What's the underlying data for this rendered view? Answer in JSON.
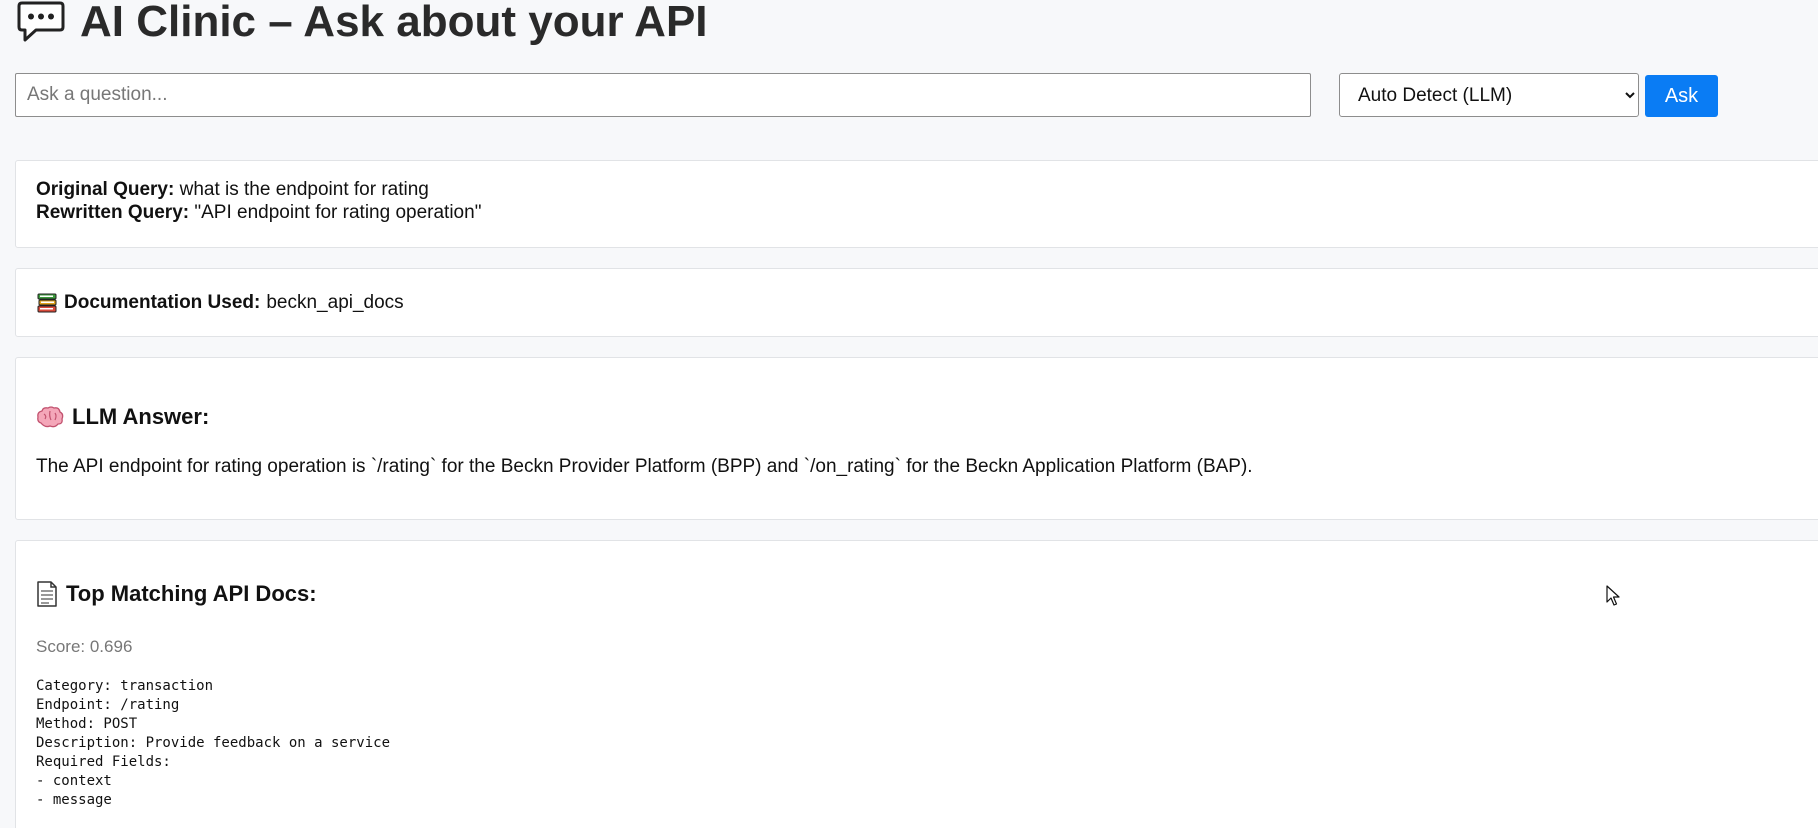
{
  "header": {
    "title": "AI Clinic – Ask about your API",
    "icon": "speech-bubble-icon"
  },
  "search": {
    "placeholder": "Ask a question...",
    "value": ""
  },
  "mode": {
    "selected": "Auto Detect (LLM)",
    "options": [
      "Auto Detect (LLM)"
    ]
  },
  "ask_button": {
    "label": "Ask",
    "color": "#0a7cf4"
  },
  "query_card": {
    "original_label": "Original Query:",
    "original_value": "what is the endpoint for rating",
    "rewritten_label": "Rewritten Query:",
    "rewritten_value": "\"API endpoint for rating operation\""
  },
  "docs_card": {
    "icon": "books-icon",
    "label": "Documentation Used:",
    "value": "beckn_api_docs"
  },
  "answer_card": {
    "icon": "brain-icon",
    "heading": "LLM Answer:",
    "text": "The API endpoint for rating operation is `/rating` for the Beckn Provider Platform (BPP) and `/on_rating` for the Beckn Application Platform (BAP)."
  },
  "matches_card": {
    "icon": "document-icon",
    "heading": "Top Matching API Docs:",
    "score": "Score: 0.696",
    "doc_text": "Category: transaction\nEndpoint: /rating\nMethod: POST\nDescription: Provide feedback on a service\nRequired Fields:\n- context\n- message"
  }
}
